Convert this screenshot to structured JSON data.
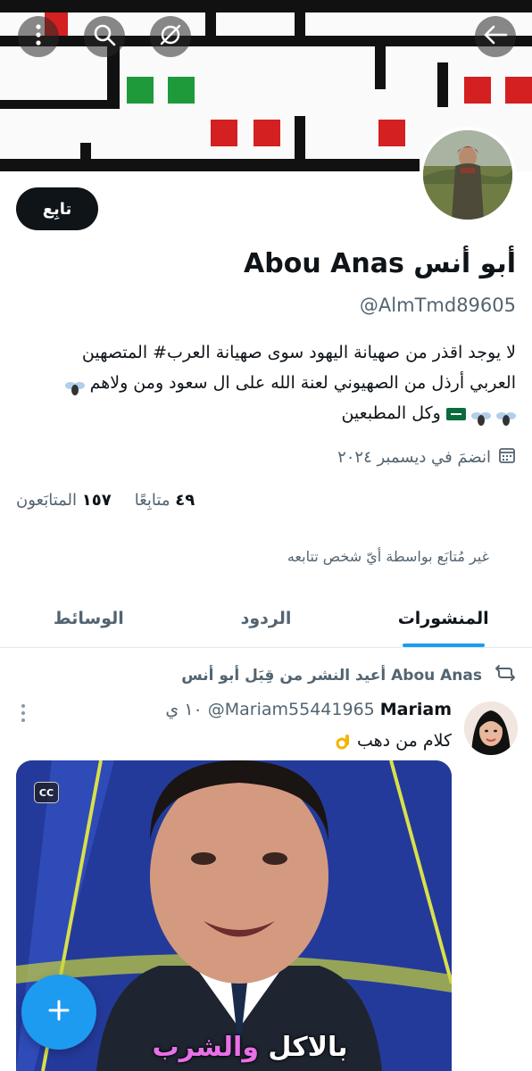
{
  "profile": {
    "display_name": "أبو أنس Abou Anas",
    "handle": "@AlmTmd89605",
    "bio_line1": "لا يوجد اقذر من صهيانة اليهود سوى صهيانة العرب# المتصهين",
    "bio_line2": "العربي أرذل من الصهيوني  لعنة الله على ال سعود ومن ولاهم",
    "bio_line3": "وكل المطبعين",
    "joined": "انضمَ في ديسمبر ٢٠٢٤",
    "followers_count": "١٥٧",
    "followers_label": "المتابَعون",
    "following_count": "٤٩",
    "following_label": "متابِعًا",
    "not_followed_note": "غير مُتابَع بواسطة أيّ شخص تتابعه",
    "follow_label": "تابِع"
  },
  "tabs": [
    {
      "label": "المنشورات",
      "active": true
    },
    {
      "label": "الردود",
      "active": false
    },
    {
      "label": "الوسائط",
      "active": false
    }
  ],
  "post": {
    "repost_note": "أعيد النشر من قِبَل أبو أنس Abou Anas",
    "author_name": "Mariam",
    "author_handle": "@Mariam55441965",
    "time": "١٠ ي",
    "text": "كلام من دهب",
    "cc_label": "CC",
    "caption_part1": "بالاكل ",
    "caption_part2": "والشرب"
  },
  "icons": {
    "back": "arrow-left-icon",
    "premium": "premium-slash-icon",
    "search": "search-icon",
    "more": "more-vertical-icon",
    "calendar": "calendar-icon",
    "repost": "repost-icon",
    "compose": "plus-icon"
  },
  "colors": {
    "accent": "#1d9bf0",
    "text": "#0f1419",
    "secondary": "#536471"
  }
}
